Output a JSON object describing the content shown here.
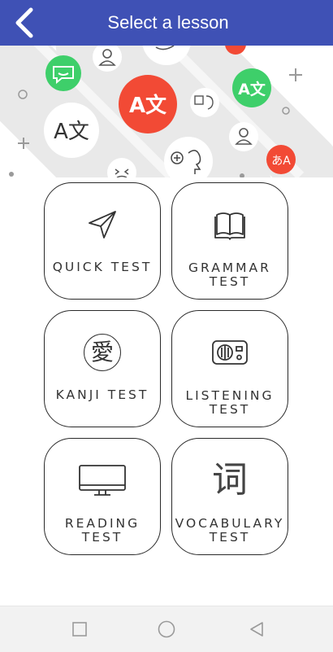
{
  "header": {
    "title": "Select a lesson",
    "bg_color": "#3f51b5",
    "back_icon": "chevron-left-icon"
  },
  "banner": {
    "bubbles": [
      {
        "icon": "chat-smile-icon",
        "color": "#3ecf6a"
      },
      {
        "icon": "translate-icon",
        "color": "#f24a35",
        "text": "A文"
      },
      {
        "icon": "translate-icon",
        "color": "#3ecf6a",
        "text": "A文"
      },
      {
        "icon": "translate-icon",
        "color": "#ffffff",
        "text": "A文"
      },
      {
        "icon": "translate-icon",
        "color": "#f24a35",
        "text": "あA"
      },
      {
        "icon": "user-icon",
        "color": "#ffffff"
      },
      {
        "icon": "user-icon",
        "color": "#ffffff"
      },
      {
        "icon": "speaking-person-icon",
        "color": "#ffffff"
      }
    ]
  },
  "lessons": [
    {
      "id": "quick",
      "line1": "QUICK TEST",
      "line2": "",
      "icon": "paper-plane-icon"
    },
    {
      "id": "grammar",
      "line1": "GRAMMAR",
      "line2": "TEST",
      "icon": "open-book-icon"
    },
    {
      "id": "kanji",
      "line1": "KANJI TEST",
      "line2": "",
      "icon": "kanji-seal-icon",
      "glyph": "愛"
    },
    {
      "id": "listening",
      "line1": "LISTENING",
      "line2": "TEST",
      "icon": "radio-icon"
    },
    {
      "id": "reading",
      "line1": "READING",
      "line2": "TEST",
      "icon": "monitor-icon"
    },
    {
      "id": "vocabulary",
      "line1": "VOCABULARY",
      "line2": "TEST",
      "icon": "word-glyph-icon",
      "glyph": "词"
    }
  ],
  "navbar": {
    "recent": "square-icon",
    "home": "circle-icon",
    "back": "triangle-back-icon"
  }
}
